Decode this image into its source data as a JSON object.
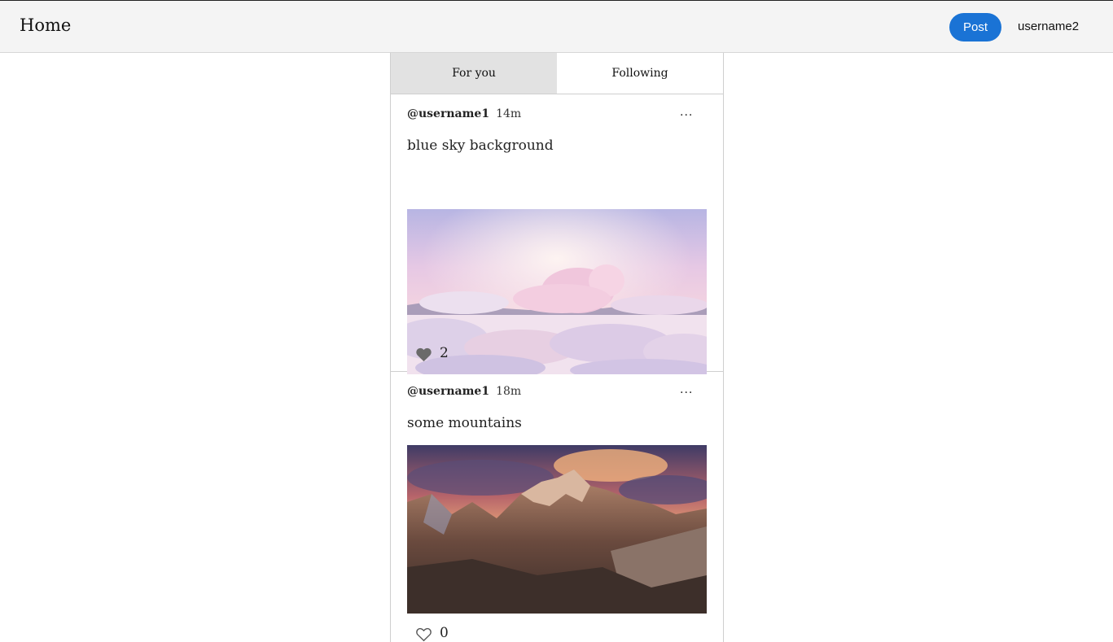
{
  "header": {
    "title": "Home",
    "post_label": "Post",
    "username": "username2",
    "accent": "#1a73d5"
  },
  "tabs": [
    {
      "label": "For you",
      "active": true
    },
    {
      "label": "Following",
      "active": false
    }
  ],
  "posts": [
    {
      "handle": "@username1",
      "time": "14m",
      "more": "...",
      "text": "blue sky background",
      "image": "pastel-clouds-sky",
      "like_icon": "heart-filled-icon",
      "likes": "2"
    },
    {
      "handle": "@username1",
      "time": "18m",
      "more": "...",
      "text": "some mountains",
      "image": "mountain-sunset",
      "like_icon": "heart-outline-icon",
      "likes": "0"
    }
  ]
}
